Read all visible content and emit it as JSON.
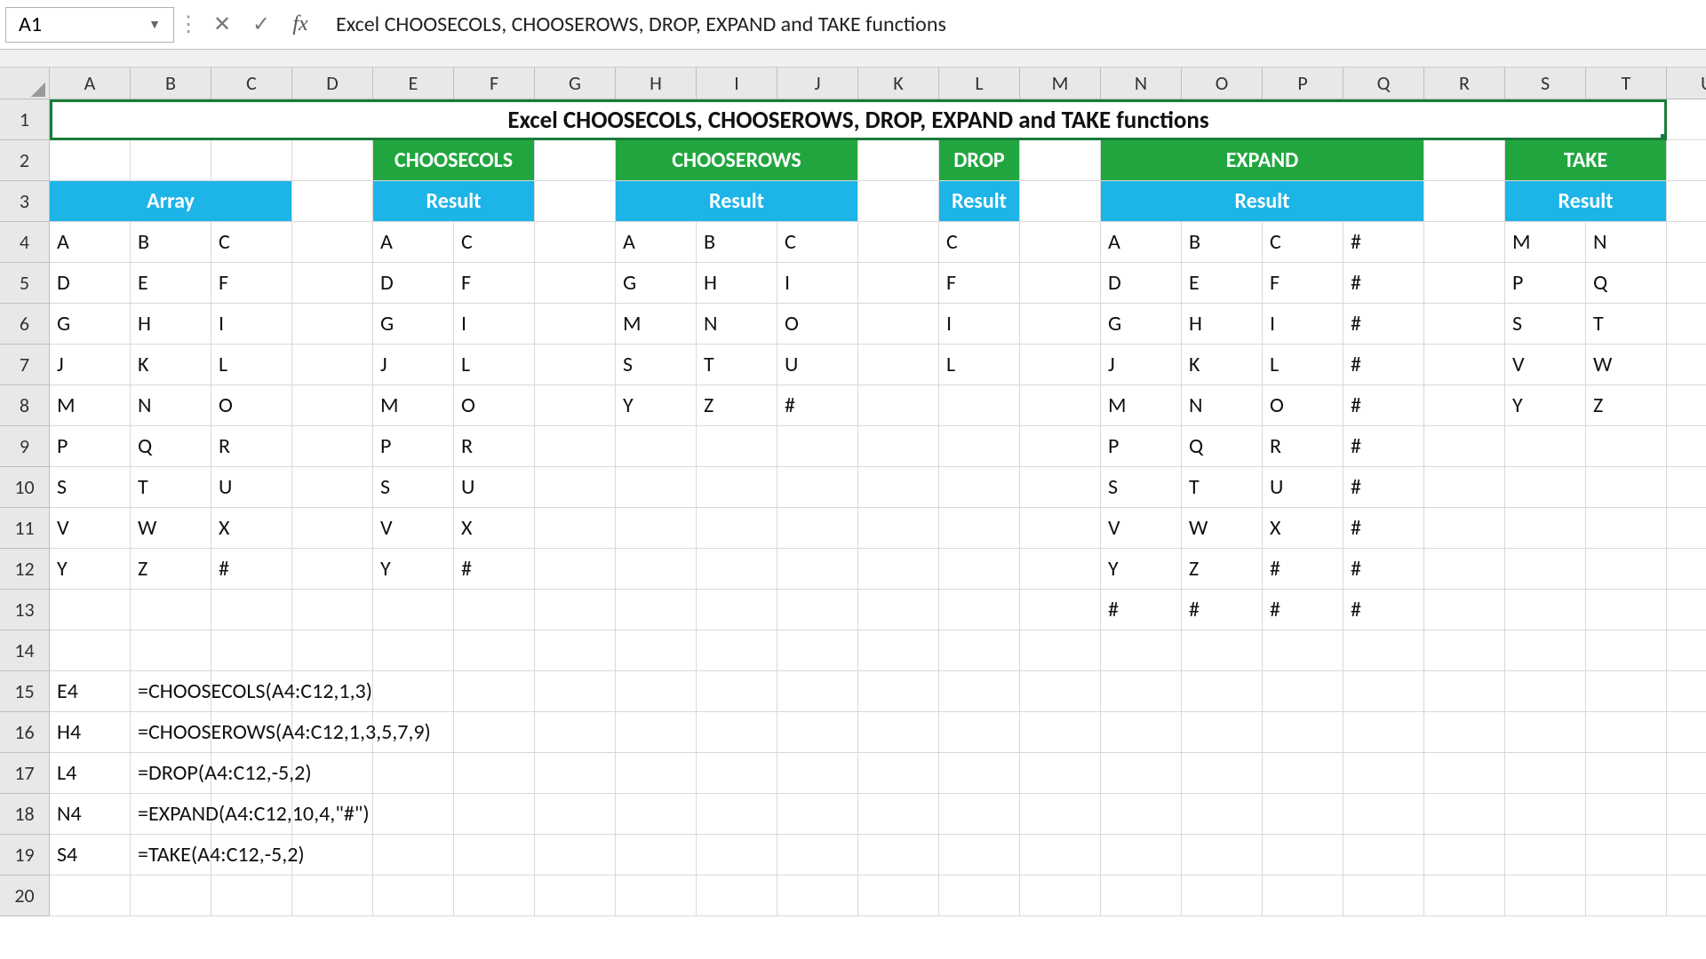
{
  "formulaBar": {
    "cellRef": "A1",
    "cancelGlyph": "✕",
    "enterGlyph": "✓",
    "fxLabel": "fx",
    "text": "Excel CHOOSECOLS, CHOOSEROWS, DROP, EXPAND and TAKE functions"
  },
  "columns": [
    "A",
    "B",
    "C",
    "D",
    "E",
    "F",
    "G",
    "H",
    "I",
    "J",
    "K",
    "L",
    "M",
    "N",
    "O",
    "P",
    "Q",
    "R",
    "S",
    "T",
    "U"
  ],
  "rows": [
    "1",
    "2",
    "3",
    "4",
    "5",
    "6",
    "7",
    "8",
    "9",
    "10",
    "11",
    "12",
    "13",
    "14",
    "15",
    "16",
    "17",
    "18",
    "19",
    "20"
  ],
  "title": "Excel CHOOSECOLS, CHOOSEROWS, DROP, EXPAND and TAKE functions",
  "headers2": {
    "choosecols": "CHOOSECOLS",
    "chooserows": "CHOOSEROWS",
    "drop": "DROP",
    "expand": "EXPAND",
    "take": "TAKE"
  },
  "headers3": {
    "array": "Array",
    "result": "Result"
  },
  "array": [
    [
      "A",
      "B",
      "C"
    ],
    [
      "D",
      "E",
      "F"
    ],
    [
      "G",
      "H",
      "I"
    ],
    [
      "J",
      "K",
      "L"
    ],
    [
      "M",
      "N",
      "O"
    ],
    [
      "P",
      "Q",
      "R"
    ],
    [
      "S",
      "T",
      "U"
    ],
    [
      "V",
      "W",
      "X"
    ],
    [
      "Y",
      "Z",
      "#"
    ]
  ],
  "choosecols": [
    [
      "A",
      "C"
    ],
    [
      "D",
      "F"
    ],
    [
      "G",
      "I"
    ],
    [
      "J",
      "L"
    ],
    [
      "M",
      "O"
    ],
    [
      "P",
      "R"
    ],
    [
      "S",
      "U"
    ],
    [
      "V",
      "X"
    ],
    [
      "Y",
      "#"
    ]
  ],
  "chooserows": [
    [
      "A",
      "B",
      "C"
    ],
    [
      "G",
      "H",
      "I"
    ],
    [
      "M",
      "N",
      "O"
    ],
    [
      "S",
      "T",
      "U"
    ],
    [
      "Y",
      "Z",
      "#"
    ]
  ],
  "drop": [
    [
      "C"
    ],
    [
      "F"
    ],
    [
      "I"
    ],
    [
      "L"
    ]
  ],
  "expand": [
    [
      "A",
      "B",
      "C",
      "#"
    ],
    [
      "D",
      "E",
      "F",
      "#"
    ],
    [
      "G",
      "H",
      "I",
      "#"
    ],
    [
      "J",
      "K",
      "L",
      "#"
    ],
    [
      "M",
      "N",
      "O",
      "#"
    ],
    [
      "P",
      "Q",
      "R",
      "#"
    ],
    [
      "S",
      "T",
      "U",
      "#"
    ],
    [
      "V",
      "W",
      "X",
      "#"
    ],
    [
      "Y",
      "Z",
      "#",
      "#"
    ],
    [
      "#",
      "#",
      "#",
      "#"
    ]
  ],
  "take": [
    [
      "M",
      "N"
    ],
    [
      "P",
      "Q"
    ],
    [
      "S",
      "T"
    ],
    [
      "V",
      "W"
    ],
    [
      "Y",
      "Z"
    ]
  ],
  "formulas": [
    {
      "ref": "E4",
      "text": "=CHOOSECOLS(A4:C12,1,3)"
    },
    {
      "ref": "H4",
      "text": "=CHOOSEROWS(A4:C12,1,3,5,7,9)"
    },
    {
      "ref": "L4",
      "text": "=DROP(A4:C12,-5,2)"
    },
    {
      "ref": "N4",
      "text": "=EXPAND(A4:C12,10,4,\"#\")"
    },
    {
      "ref": "S4",
      "text": "=TAKE(A4:C12,-5,2)"
    }
  ],
  "chart_data": {
    "type": "table",
    "title": "Excel CHOOSECOLS, CHOOSEROWS, DROP, EXPAND and TAKE functions",
    "input_array_range": "A4:C12",
    "input_array": [
      [
        "A",
        "B",
        "C"
      ],
      [
        "D",
        "E",
        "F"
      ],
      [
        "G",
        "H",
        "I"
      ],
      [
        "J",
        "K",
        "L"
      ],
      [
        "M",
        "N",
        "O"
      ],
      [
        "P",
        "Q",
        "R"
      ],
      [
        "S",
        "T",
        "U"
      ],
      [
        "V",
        "W",
        "X"
      ],
      [
        "Y",
        "Z",
        "#"
      ]
    ],
    "functions": [
      {
        "name": "CHOOSECOLS",
        "formula": "=CHOOSECOLS(A4:C12,1,3)",
        "output_start": "E4",
        "result": [
          [
            "A",
            "C"
          ],
          [
            "D",
            "F"
          ],
          [
            "G",
            "I"
          ],
          [
            "J",
            "L"
          ],
          [
            "M",
            "O"
          ],
          [
            "P",
            "R"
          ],
          [
            "S",
            "U"
          ],
          [
            "V",
            "X"
          ],
          [
            "Y",
            "#"
          ]
        ]
      },
      {
        "name": "CHOOSEROWS",
        "formula": "=CHOOSEROWS(A4:C12,1,3,5,7,9)",
        "output_start": "H4",
        "result": [
          [
            "A",
            "B",
            "C"
          ],
          [
            "G",
            "H",
            "I"
          ],
          [
            "M",
            "N",
            "O"
          ],
          [
            "S",
            "T",
            "U"
          ],
          [
            "Y",
            "Z",
            "#"
          ]
        ]
      },
      {
        "name": "DROP",
        "formula": "=DROP(A4:C12,-5,2)",
        "output_start": "L4",
        "result": [
          [
            "C"
          ],
          [
            "F"
          ],
          [
            "I"
          ],
          [
            "L"
          ]
        ]
      },
      {
        "name": "EXPAND",
        "formula": "=EXPAND(A4:C12,10,4,\"#\")",
        "output_start": "N4",
        "result": [
          [
            "A",
            "B",
            "C",
            "#"
          ],
          [
            "D",
            "E",
            "F",
            "#"
          ],
          [
            "G",
            "H",
            "I",
            "#"
          ],
          [
            "J",
            "K",
            "L",
            "#"
          ],
          [
            "M",
            "N",
            "O",
            "#"
          ],
          [
            "P",
            "Q",
            "R",
            "#"
          ],
          [
            "S",
            "T",
            "U",
            "#"
          ],
          [
            "V",
            "W",
            "X",
            "#"
          ],
          [
            "Y",
            "Z",
            "#",
            "#"
          ],
          [
            "#",
            "#",
            "#",
            "#"
          ]
        ]
      },
      {
        "name": "TAKE",
        "formula": "=TAKE(A4:C12,-5,2)",
        "output_start": "S4",
        "result": [
          [
            "M",
            "N"
          ],
          [
            "P",
            "Q"
          ],
          [
            "S",
            "T"
          ],
          [
            "V",
            "W"
          ],
          [
            "Y",
            "Z"
          ]
        ]
      }
    ]
  }
}
